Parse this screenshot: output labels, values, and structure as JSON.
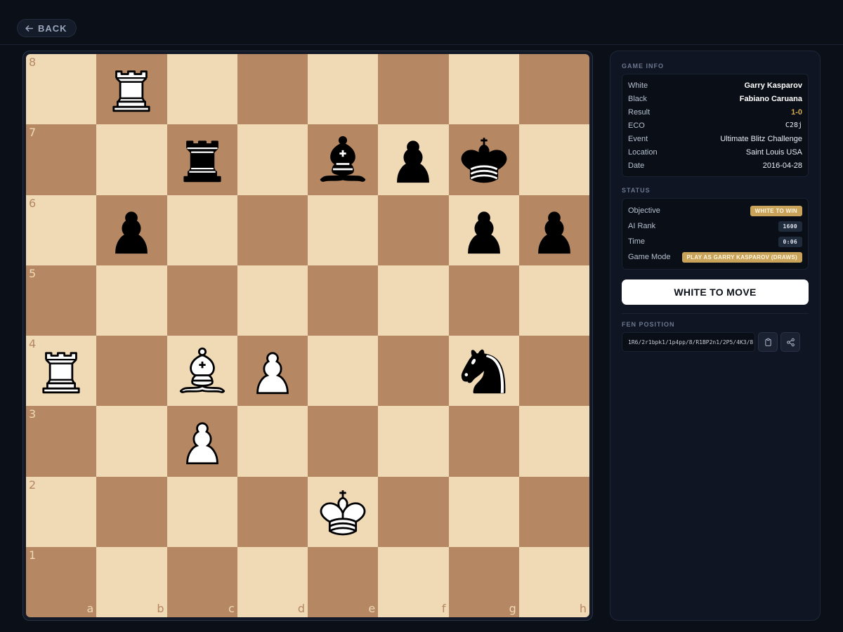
{
  "back": {
    "label": "BACK"
  },
  "board": {
    "files": [
      "a",
      "b",
      "c",
      "d",
      "e",
      "f",
      "g",
      "h"
    ],
    "ranks": [
      "8",
      "7",
      "6",
      "5",
      "4",
      "3",
      "2",
      "1"
    ],
    "light_color": "#f0d9b5",
    "dark_color": "#b58863",
    "pieces": [
      {
        "square": "b8",
        "type": "rook",
        "color": "white"
      },
      {
        "square": "c7",
        "type": "rook",
        "color": "black"
      },
      {
        "square": "e7",
        "type": "bishop",
        "color": "black"
      },
      {
        "square": "f7",
        "type": "pawn",
        "color": "black"
      },
      {
        "square": "g7",
        "type": "king",
        "color": "black"
      },
      {
        "square": "b6",
        "type": "pawn",
        "color": "black"
      },
      {
        "square": "g6",
        "type": "pawn",
        "color": "black"
      },
      {
        "square": "h6",
        "type": "pawn",
        "color": "black"
      },
      {
        "square": "a4",
        "type": "rook",
        "color": "white"
      },
      {
        "square": "c4",
        "type": "bishop",
        "color": "white"
      },
      {
        "square": "d4",
        "type": "pawn",
        "color": "white"
      },
      {
        "square": "g4",
        "type": "knight",
        "color": "black"
      },
      {
        "square": "c3",
        "type": "pawn",
        "color": "white"
      },
      {
        "square": "e2",
        "type": "king",
        "color": "white"
      }
    ]
  },
  "game_info": {
    "title": "GAME INFO",
    "white_label": "White",
    "white_value": "Garry Kasparov",
    "black_label": "Black",
    "black_value": "Fabiano Caruana",
    "result_label": "Result",
    "result_value": "1-0",
    "eco_label": "ECO",
    "eco_value": "C28j",
    "event_label": "Event",
    "event_value": "Ultimate Blitz Challenge",
    "location_label": "Location",
    "location_value": "Saint Louis USA",
    "date_label": "Date",
    "date_value": "2016-04-28"
  },
  "status": {
    "title": "STATUS",
    "objective_label": "Objective",
    "objective_value": "WHITE TO WIN",
    "rank_label": "AI Rank",
    "rank_value": "1600",
    "time_label": "Time",
    "time_value": "0:06",
    "mode_label": "Game Mode",
    "mode_value": "PLAY AS GARRY KASPAROV (DRAWS)"
  },
  "turn": {
    "label": "WHITE TO MOVE"
  },
  "fen": {
    "title": "FEN POSITION",
    "value": "1R6/2r1bpk1/1p4pp/8/R1BP2n1/2P5/4K3/8"
  },
  "colors": {
    "accent": "#c9a35a",
    "background": "#0b0f17"
  }
}
